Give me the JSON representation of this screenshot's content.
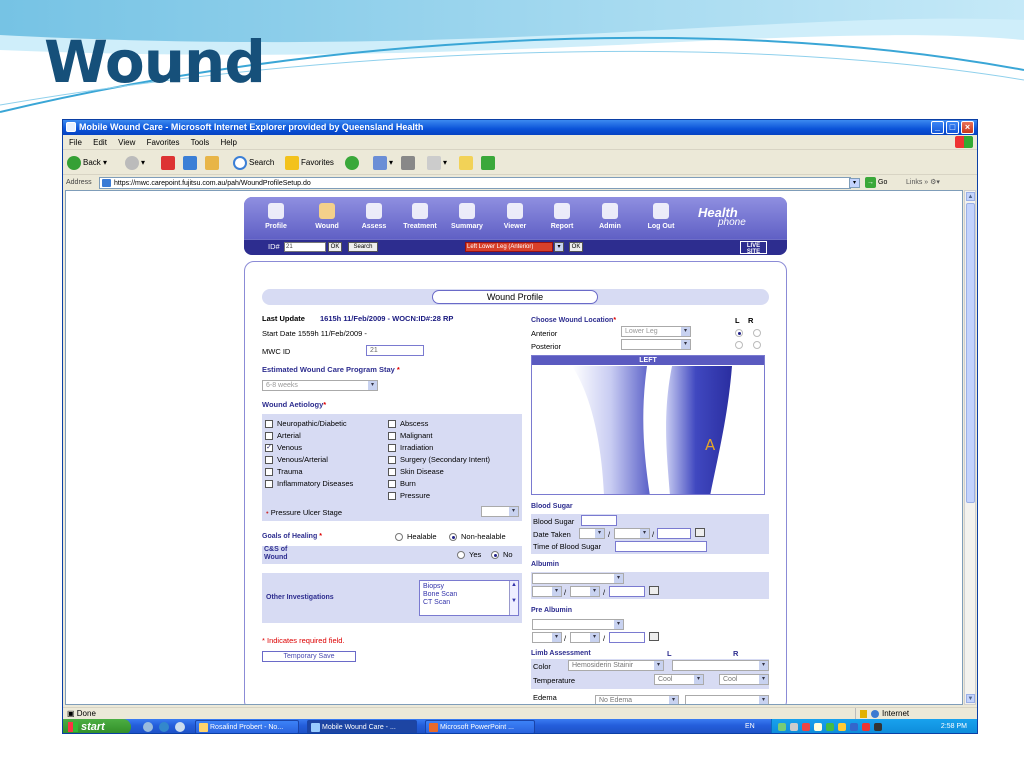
{
  "slide": {
    "title": "Wound"
  },
  "window": {
    "title": "Mobile Wound Care - Microsoft Internet Explorer provided by Queensland Health",
    "menu": [
      "File",
      "Edit",
      "View",
      "Favorites",
      "Tools",
      "Help"
    ],
    "toolbar": {
      "back": "Back",
      "search": "Search",
      "favorites": "Favorites"
    },
    "address_label": "Address",
    "url": "https://mwc.carepoint.fujitsu.com.au/pah/WoundProfileSetup.do",
    "go": "Go",
    "links": "Links",
    "status": "Done",
    "zone": "Internet"
  },
  "taskbar": {
    "start": "start",
    "tasks": [
      "Rosalind Probert - No...",
      "Mobile Wound Care - ...",
      "Microsoft PowerPoint ..."
    ],
    "lang": "EN",
    "clock": "2:58 PM"
  },
  "app": {
    "nav": [
      "Profile",
      "Wound",
      "Assess",
      "Treatment",
      "Summary",
      "Viewer",
      "Report",
      "Admin",
      "Log Out"
    ],
    "logo_top": "Health",
    "logo_bottom": "phone",
    "id_label": "ID#",
    "id_value": "21",
    "ok": "OK",
    "search": "Search",
    "location_value": "Left Lower Leg (Anterior)",
    "live_top": "LIVE",
    "live_bottom": "SITE"
  },
  "form": {
    "header": "Wound Profile",
    "last_update_label": "Last Update",
    "last_update_value": "1615h 11/Feb/2009 - WOCN:ID#:28 RP",
    "start_date": "Start Date 1559h 11/Feb/2009 -",
    "mwc_id_label": "MWC ID",
    "mwc_id_value": "21",
    "stay_label": "Estimated Wound Care Program Stay",
    "stay_value": "6-8 weeks",
    "aetiology_label": "Wound Aetiology",
    "aetiology_left": [
      {
        "label": "Neuropathic/Diabetic",
        "checked": false
      },
      {
        "label": "Arterial",
        "checked": false
      },
      {
        "label": "Venous",
        "checked": true
      },
      {
        "label": "Venous/Arterial",
        "checked": false
      },
      {
        "label": "Trauma",
        "checked": false
      },
      {
        "label": "Inflammatory Diseases",
        "checked": false
      }
    ],
    "aetiology_right": [
      {
        "label": "Abscess",
        "checked": false
      },
      {
        "label": "Malignant",
        "checked": false
      },
      {
        "label": "Irradiation",
        "checked": false
      },
      {
        "label": "Surgery (Secondary Intent)",
        "checked": false
      },
      {
        "label": "Skin Disease",
        "checked": false
      },
      {
        "label": "Burn",
        "checked": false
      },
      {
        "label": "Pressure",
        "checked": false
      }
    ],
    "pressure_ulcer_label": "Pressure Ulcer Stage",
    "goals_label": "Goals of Healing",
    "goal_opts": [
      "Healable",
      "Non-healable"
    ],
    "goal_selected": "Non-healable",
    "cs_label_1": "C&S of",
    "cs_label_2": "Wound",
    "cs_opts": [
      "Yes",
      "No"
    ],
    "cs_selected": "No",
    "other_inv_label": "Other Investigations",
    "other_inv_items": [
      "Biopsy",
      "Bone Scan",
      "CT Scan"
    ],
    "required_note": "* Indicates required field.",
    "temp_save": "Temporary Save",
    "location_label": "Choose Wound Location",
    "L": "L",
    "R": "R",
    "anterior_label": "Anterior",
    "anterior_value": "Lower Leg",
    "posterior_label": "Posterior",
    "image_side": "LEFT",
    "image_marker": "A",
    "blood_sugar_heading": "Blood Sugar",
    "blood_sugar_label": "Blood Sugar",
    "date_taken_label": "Date Taken",
    "time_label": "Time of Blood Sugar",
    "albumin_heading": "Albumin",
    "pre_albumin_heading": "Pre Albumin",
    "limb_heading": "Limb Assessment",
    "limb_L": "L",
    "limb_R": "R",
    "color_label": "Color",
    "color_value": "Hemosiderin Stainir",
    "temp_label": "Temperature",
    "temp_L": "Cool",
    "temp_R": "Cool",
    "edema_label": "Edema",
    "edema_value": "No Edema",
    "colors": {
      "accent": "#2d2d8f",
      "shade": "#d7dbf3",
      "required": "#dd0000"
    }
  }
}
